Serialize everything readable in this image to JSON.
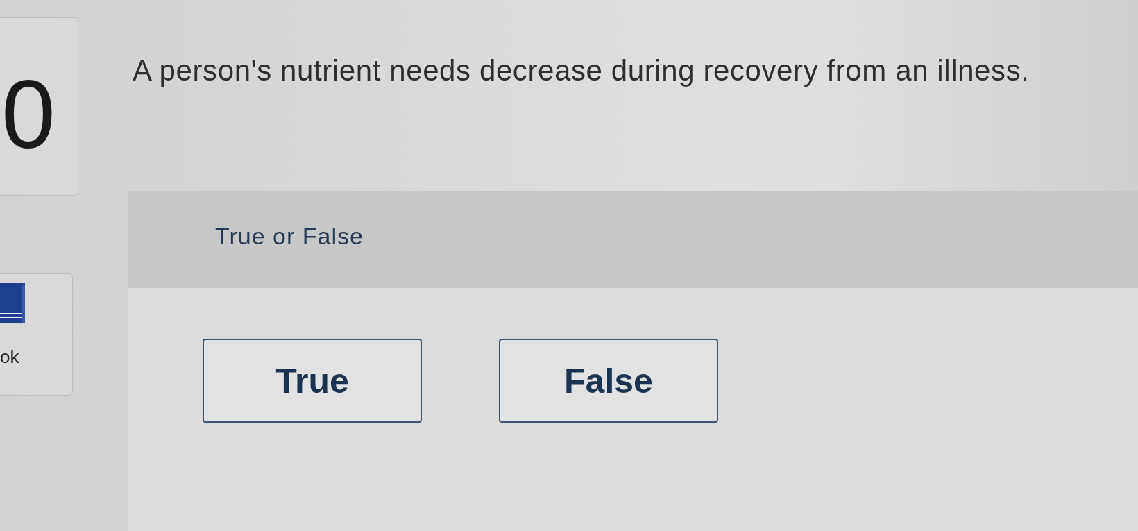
{
  "sidebar": {
    "cards": [
      {
        "kind": "score",
        "text": "0"
      },
      {
        "kind": "resource",
        "text": "ok"
      }
    ]
  },
  "question": {
    "prompt": "A person's nutrient needs decrease during recovery from an illness.",
    "type_label": "True or False",
    "answers": [
      {
        "label": "True",
        "selected": false
      },
      {
        "label": "False",
        "selected": false
      }
    ]
  }
}
